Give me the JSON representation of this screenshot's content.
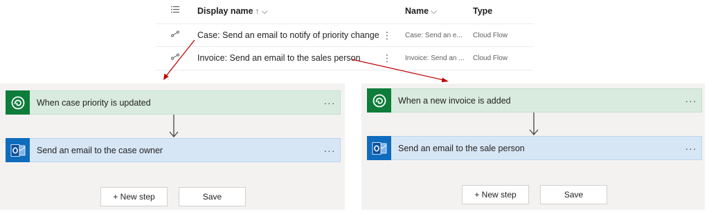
{
  "list": {
    "headers": {
      "display_name": "Display name",
      "display_name_sort": "↑",
      "display_name_chevron": "⌵",
      "name": "Name",
      "name_chevron": "⌵",
      "type": "Type"
    },
    "rows": [
      {
        "display_name": "Case: Send an email to notify of priority change",
        "name": "Case: Send an e...",
        "type": "Cloud Flow"
      },
      {
        "display_name": "Invoice: Send an email to the sales person",
        "name": "Invoice: Send an ...",
        "type": "Cloud Flow"
      }
    ],
    "row_menu_glyph": "⋮"
  },
  "flows": [
    {
      "trigger_title": "When case priority is updated",
      "action_title": "Send an email to the case owner",
      "new_step_label": "+ New step",
      "save_label": "Save"
    },
    {
      "trigger_title": "When a new invoice is added",
      "action_title": "Send an email to the sale person",
      "new_step_label": "+ New step",
      "save_label": "Save"
    }
  ],
  "more_glyph": "···",
  "colors": {
    "trigger_bg": "#d9ebdf",
    "trigger_badge": "#0e7c3a",
    "action_bg": "#d7e6f5",
    "action_badge": "#0f6cbd",
    "annotation_arrow": "#c00000",
    "panel_bg": "#f3f2f1"
  },
  "icons": {
    "list_header": "list-view-icon",
    "row": "cloud-flow-icon",
    "trigger": "dataverse-icon",
    "action": "outlook-icon"
  }
}
